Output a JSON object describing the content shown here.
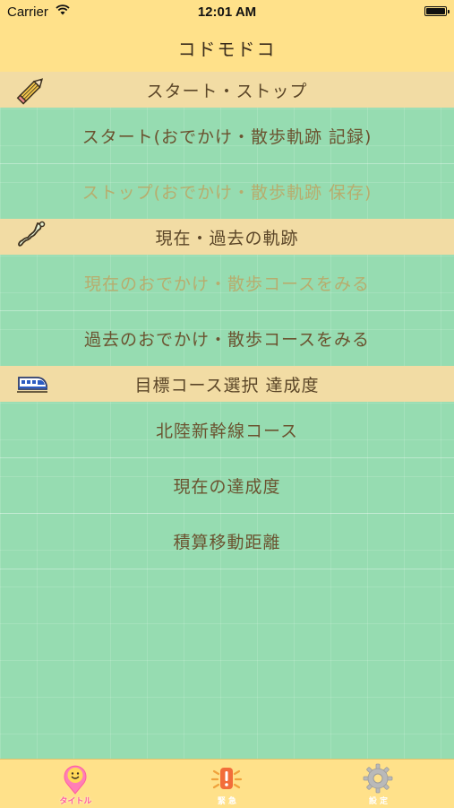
{
  "status_bar": {
    "carrier": "Carrier",
    "time": "12:01 AM"
  },
  "nav": {
    "title": "コドモドコ"
  },
  "sections": [
    {
      "title": "スタート・ストップ",
      "icon": "pencil-icon",
      "rows": [
        {
          "label": "スタート(おでかけ・散歩軌跡 記録)",
          "enabled": true
        },
        {
          "label": "ストップ(おでかけ・散歩軌跡 保存)",
          "enabled": false
        }
      ]
    },
    {
      "title": "現在・過去の軌跡",
      "icon": "japan-map-icon",
      "rows": [
        {
          "label": "現在のおでかけ・散歩コースをみる",
          "enabled": false
        },
        {
          "label": "過去のおでかけ・散歩コースをみる",
          "enabled": true
        }
      ]
    },
    {
      "title": "目標コース選択 達成度",
      "icon": "bullet-train-icon",
      "rows": [
        {
          "label": "北陸新幹線コース",
          "enabled": true
        },
        {
          "label": "現在の達成度",
          "enabled": true
        },
        {
          "label": "積算移動距離",
          "enabled": true
        }
      ]
    }
  ],
  "tabs": [
    {
      "label": "タイトル",
      "icon": "location-pin-smile-icon",
      "active": true
    },
    {
      "label": "緊 急",
      "icon": "emergency-alert-icon",
      "active": false
    },
    {
      "label": "設 定",
      "icon": "gear-icon",
      "active": false
    }
  ],
  "colors": {
    "nav_background": "#ffe18a",
    "content_background": "#96dcb1",
    "section_header": "#f2dca4",
    "text": "#6b5330",
    "disabled_text": "#b7ad6e",
    "active_tab": "#ff5ea1"
  }
}
